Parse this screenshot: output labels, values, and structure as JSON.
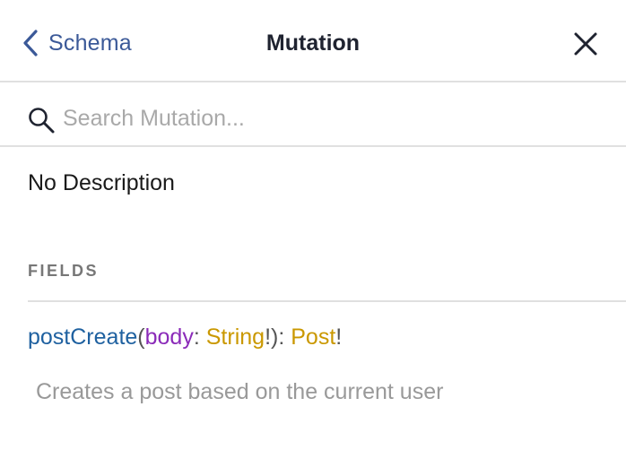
{
  "header": {
    "back_label": "Schema",
    "title": "Mutation"
  },
  "search": {
    "placeholder": "Search Mutation..."
  },
  "description": "No Description",
  "fields_section": {
    "title": "FIELDS",
    "fields": [
      {
        "name": "postCreate",
        "open_paren": "(",
        "arg_name": "body",
        "arg_colon": ": ",
        "arg_type": "String",
        "arg_bang": "!",
        "close_paren_colon": "): ",
        "return_type": "Post",
        "return_bang": "!",
        "description": "Creates a post based on the current user"
      }
    ]
  },
  "colors": {
    "link": "#3b5998",
    "field_name": "#1f61a0",
    "arg_name": "#8b2bb9",
    "type_name": "#ca9800"
  },
  "icons": [
    "chevron-left-icon",
    "close-icon",
    "search-icon"
  ]
}
